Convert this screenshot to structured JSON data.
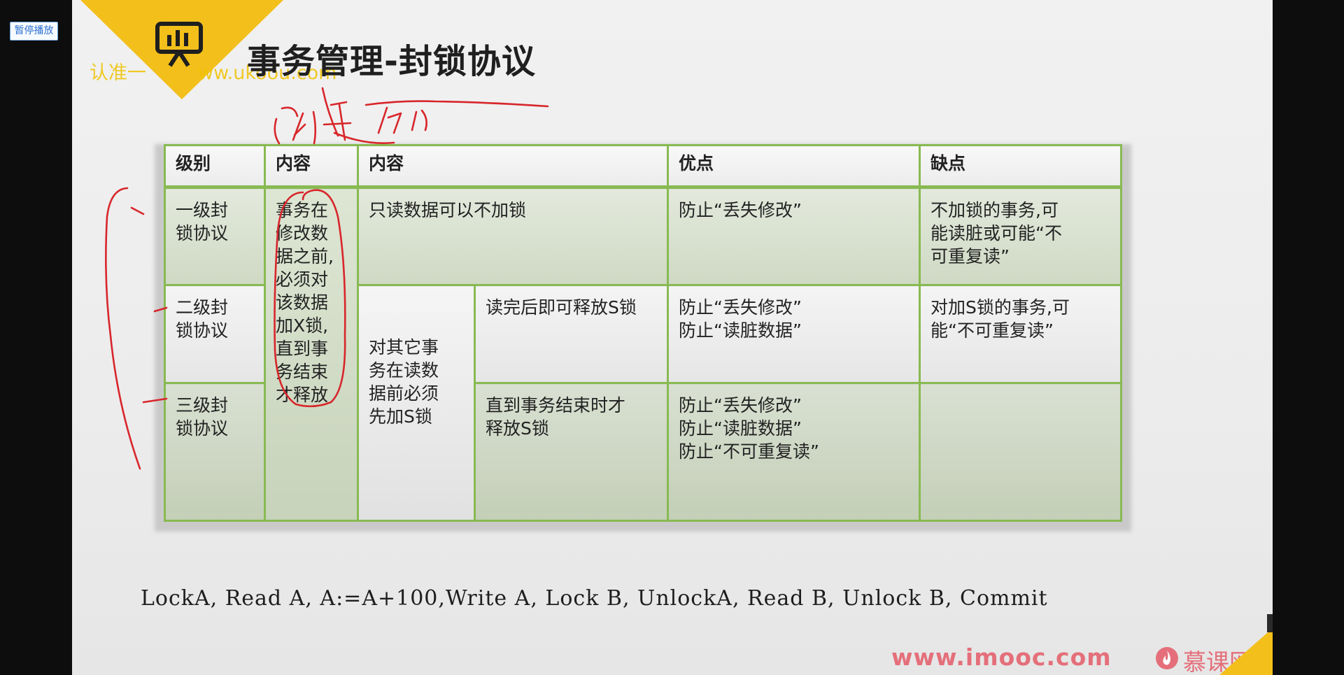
{
  "player": {
    "pause_label": "暂停播放"
  },
  "slide": {
    "title": "事务管理-封锁协议",
    "watermark_left": "认准一",
    "watermark_right": "ww.ukoou.com",
    "accent_color": "#f3bf1a",
    "logo_icon": "presentation-board-icon"
  },
  "table": {
    "header": [
      "级别",
      "内容",
      "内容",
      "优点",
      "缺点"
    ],
    "shared_x_lock": [
      "事务在",
      "修改数",
      "据之前,",
      "必须对",
      "该数据",
      "加X锁,",
      "直到事",
      "务结束",
      "才释放"
    ],
    "shared_s_lock": [
      "对其它事",
      "务在读数",
      "据前必须",
      "先加S锁"
    ],
    "rows": [
      {
        "level": [
          "一级封",
          "锁协议"
        ],
        "content": "只读数据可以不加锁",
        "advantages": [
          "防止“丢失修改”"
        ],
        "disadvantages": [
          "不加锁的事务,可",
          "能读脏或可能“不",
          "可重复读”"
        ]
      },
      {
        "level": [
          "二级封",
          "锁协议"
        ],
        "content": "读完后即可释放S锁",
        "advantages": [
          "防止“丢失修改”",
          "防止“读脏数据”"
        ],
        "disadvantages": [
          "对加S锁的事务,可",
          "能“不可重复读”"
        ]
      },
      {
        "level": [
          "三级封",
          "锁协议"
        ],
        "content": [
          "直到事务结束时才",
          "释放S锁"
        ],
        "advantages": [
          "防止“丢失修改”",
          "防止“读脏数据”",
          "防止“不可重复读”"
        ],
        "disadvantages": []
      }
    ],
    "border_color": "#88ba52"
  },
  "sequence": "LockA, Read A, A:=A+100,Write A, Lock B, UnlockA, Read B, Unlock B, Commit",
  "footer": {
    "site": "www.imooc.com",
    "brand": "慕课网",
    "brand_color": "#e46f7a",
    "brand_icon": "imooc-flame-icon"
  }
}
